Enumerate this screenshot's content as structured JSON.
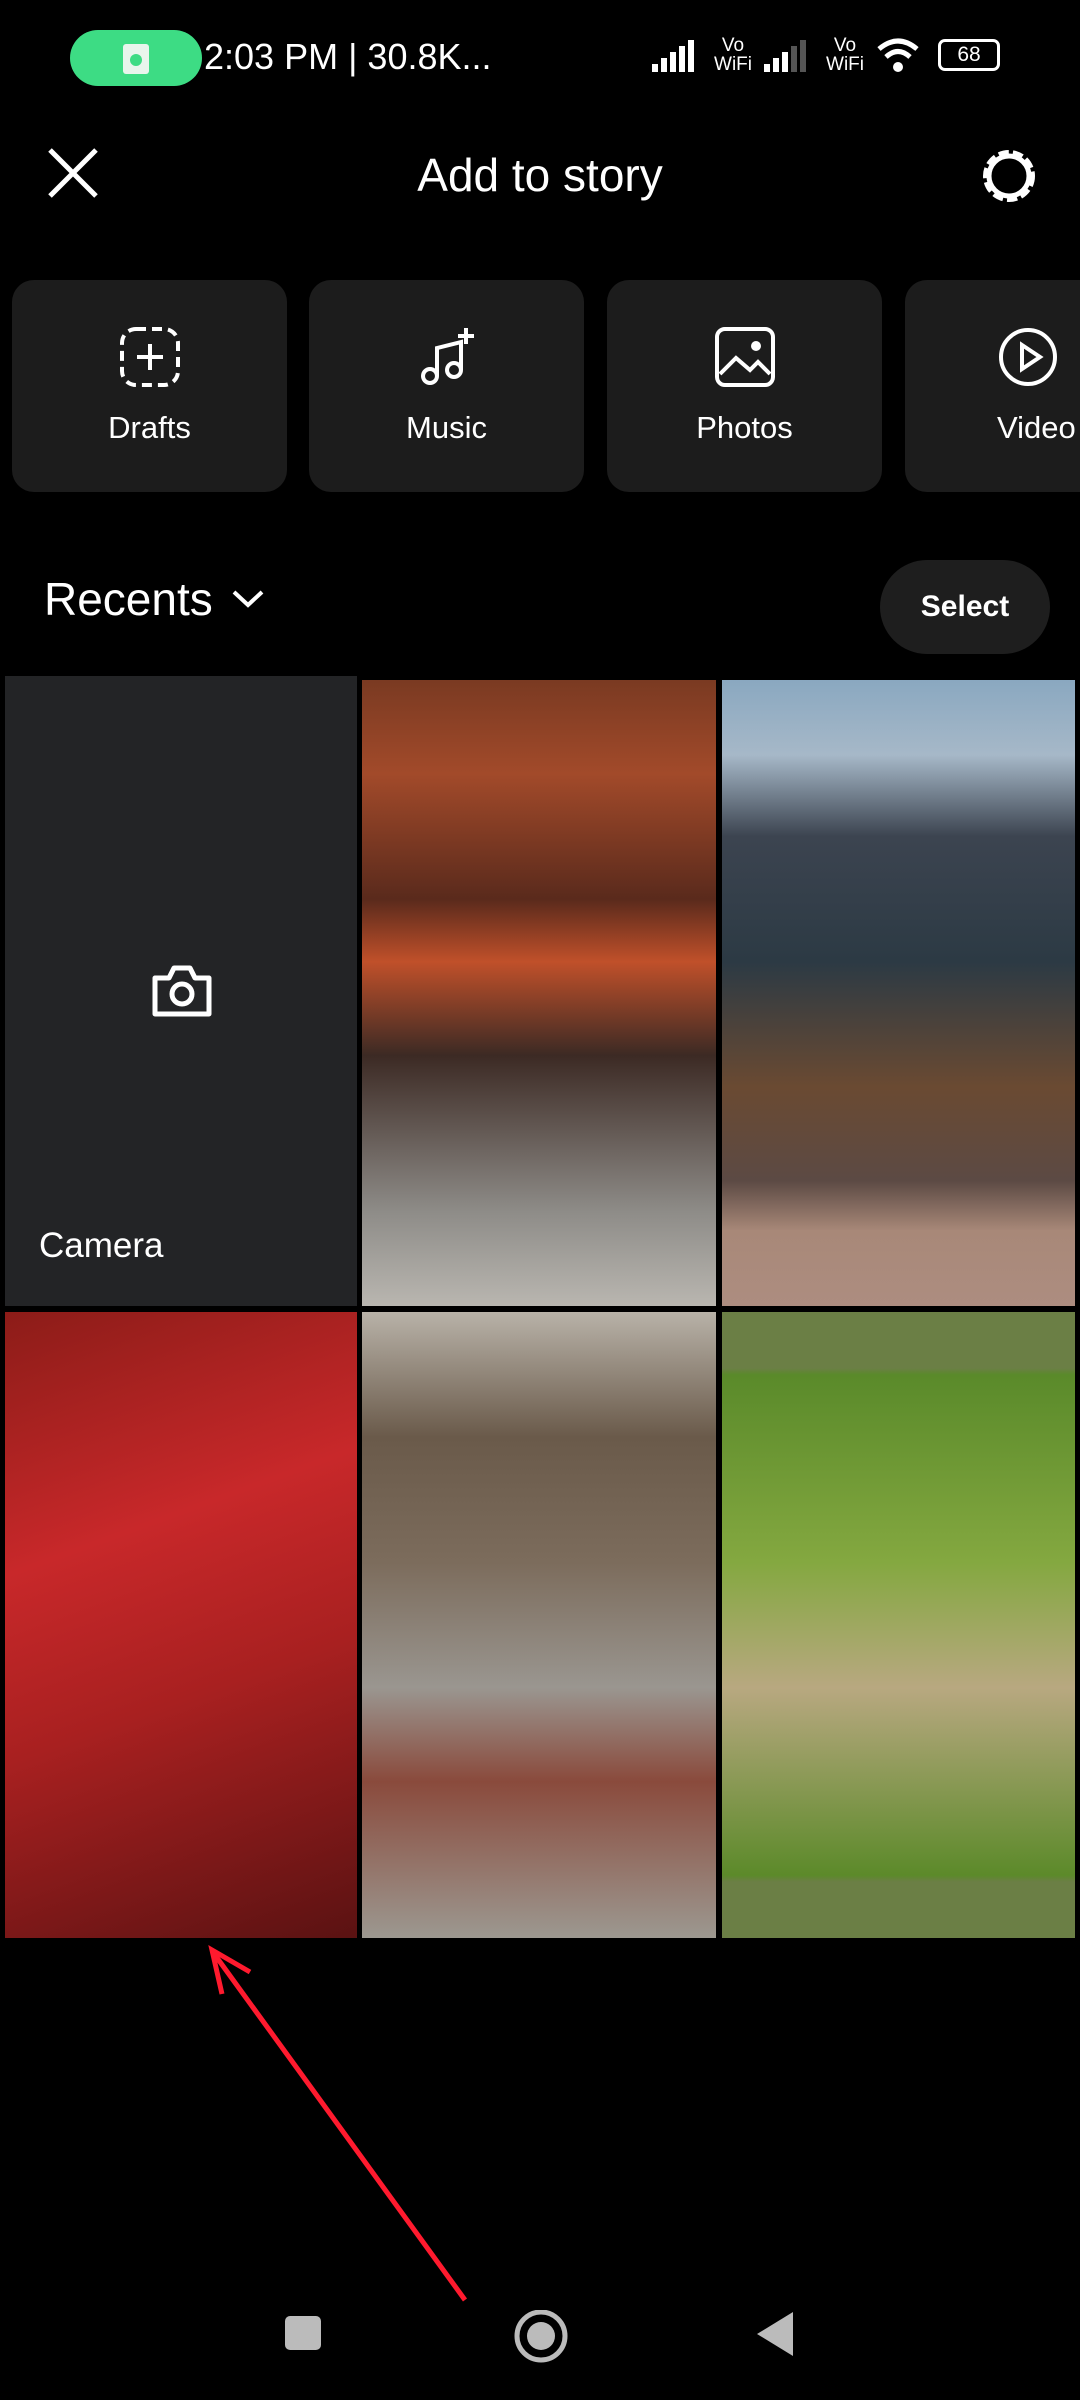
{
  "status": {
    "time_text": "2:03 PM | 30.8K...",
    "net1": "Vo\nWiFi",
    "net2": "Vo\nWiFi",
    "battery": "68",
    "accent": "#3ddc84"
  },
  "header": {
    "title": "Add to story"
  },
  "tiles": [
    {
      "label": "Drafts",
      "icon": "drafts-icon"
    },
    {
      "label": "Music",
      "icon": "music-plus-icon"
    },
    {
      "label": "Photos",
      "icon": "image-icon"
    },
    {
      "label": "Video",
      "icon": "play-circle-icon"
    }
  ],
  "recents": {
    "label": "Recents",
    "select": "Select"
  },
  "grid": {
    "camera_label": "Camera"
  },
  "annotation": {
    "arrow_color": "#ff1a2e"
  }
}
